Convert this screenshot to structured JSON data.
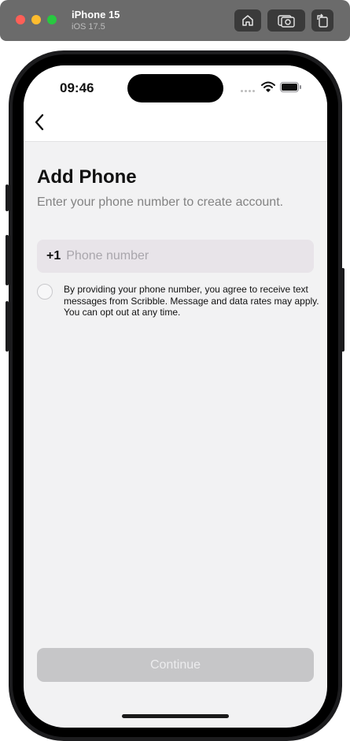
{
  "simulator": {
    "device_name": "iPhone 15",
    "os_version": "iOS 17.5",
    "buttons": {
      "home_icon": "home-icon",
      "screenshot_icon": "screenshot-icon",
      "rotate_icon": "rotate-icon"
    }
  },
  "status_bar": {
    "time": "09:46",
    "icons": [
      "cellular-dots-icon",
      "wifi-icon",
      "battery-icon"
    ]
  },
  "nav": {
    "back_icon": "chevron-left-icon"
  },
  "main": {
    "title": "Add Phone",
    "subtitle": "Enter your phone number to create account.",
    "phone": {
      "country_code": "+1",
      "placeholder": "Phone number",
      "value": ""
    },
    "consent": {
      "checked": false,
      "text": "By providing your phone number, you agree to receive text messages from Scribble. Message and data rates may apply. You can opt out at any time."
    },
    "continue_label": "Continue"
  },
  "colors": {
    "screen_background": "#f2f2f3",
    "field_background": "#e8e4e9",
    "button_disabled": "#c6c6c8",
    "button_text_disabled": "#ececee",
    "subtitle_text": "#838383"
  }
}
